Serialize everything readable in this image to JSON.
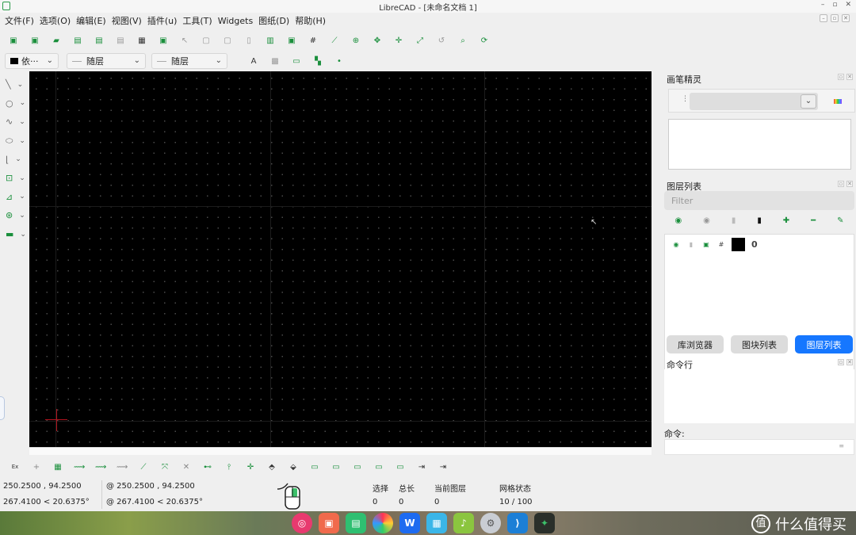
{
  "window": {
    "title": "LibreCAD - [未命名文档 1]"
  },
  "menu": [
    "文件(F)",
    "选项(O)",
    "编辑(E)",
    "视图(V)",
    "插件(u)",
    "工具(T)",
    "Widgets",
    "图纸(D)",
    "帮助(H)"
  ],
  "toolbar": {
    "icons": [
      "new-icon",
      "new-template-icon",
      "open-icon",
      "save-icon",
      "save-as-icon",
      "export-icon",
      "print-icon",
      "print-preview-icon",
      "select-icon",
      "copy-icon",
      "paste-icon",
      "cut-icon",
      "block-icon",
      "insert-icon",
      "grid-icon",
      "draft-icon",
      "zoom-in-icon",
      "zoom-out-icon",
      "pan-icon",
      "zoom-auto-icon",
      "zoom-previous-icon",
      "zoom-window-icon",
      "redraw-icon"
    ]
  },
  "attributes": {
    "color_label": "依···",
    "line_width_label": "随层",
    "line_type_label": "随层"
  },
  "pen_wizard": {
    "title": "画笔精灵"
  },
  "layer_list": {
    "title": "图层列表",
    "filter_placeholder": "Filter",
    "layers": [
      {
        "name": "0",
        "color": "#000000"
      }
    ]
  },
  "tabs": [
    {
      "label": "库浏览器",
      "active": false
    },
    {
      "label": "图块列表",
      "active": false
    },
    {
      "label": "图层列表",
      "active": true
    }
  ],
  "command": {
    "title": "命令行",
    "label": "命令:"
  },
  "status": {
    "abs_coord": "250.2500 , 94.2500",
    "abs_polar": "267.4100 < 20.6375°",
    "rel_coord": "@  250.2500 , 94.2500",
    "rel_polar": "@  267.4100 < 20.6375°",
    "selected_label": "选择",
    "selected_value": "0",
    "total_label": "总长",
    "total_value": "0",
    "layer_label": "当前图层",
    "layer_value": "0",
    "grid_label": "网格状态",
    "grid_value": "10 / 100"
  },
  "taskbar": {
    "watermark": "什么值得买",
    "watermark_badge": "值"
  },
  "colors": {
    "accent": "#1677ff",
    "icon_green": "#1a8f3c",
    "canvas_bg": "#000000",
    "cross": "#b0141e"
  }
}
